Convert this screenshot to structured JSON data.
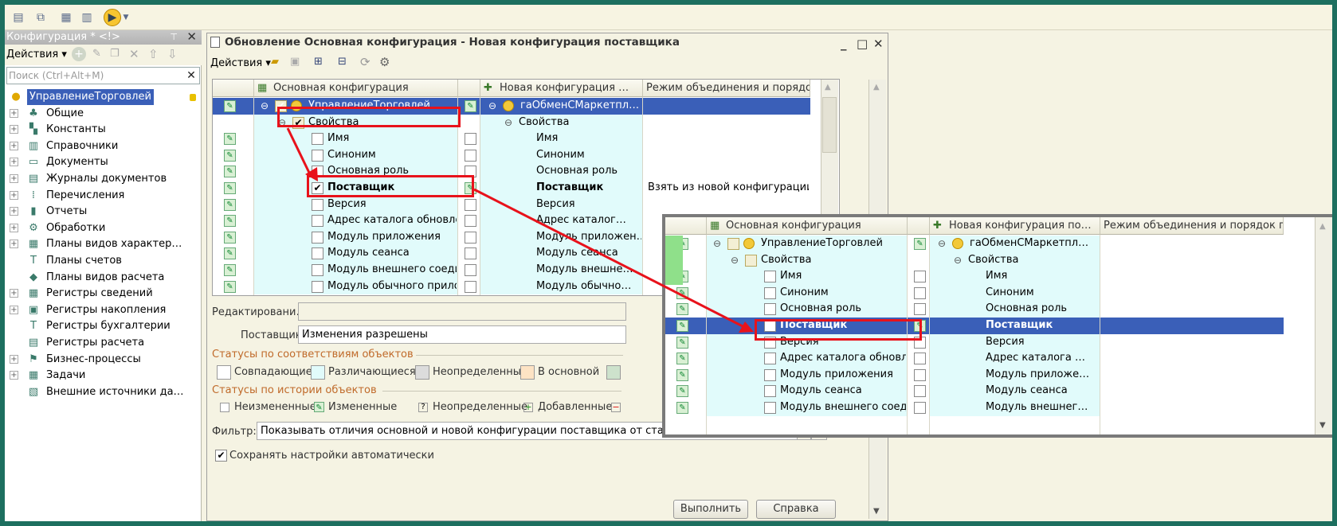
{
  "left_panel": {
    "title": "Конфигурация * <!>",
    "actions_label": "Действия",
    "search_placeholder": "Поиск (Ctrl+Alt+M)",
    "items": [
      {
        "label": "УправлениеТорговлей",
        "icon": "config-root-icon",
        "expand": false
      },
      {
        "label": "Общие",
        "icon": "common-icon",
        "expand": true
      },
      {
        "label": "Константы",
        "icon": "constants-icon",
        "expand": true
      },
      {
        "label": "Справочники",
        "icon": "catalogs-icon",
        "expand": true
      },
      {
        "label": "Документы",
        "icon": "documents-icon",
        "expand": true
      },
      {
        "label": "Журналы документов",
        "icon": "journals-icon",
        "expand": true
      },
      {
        "label": "Перечисления",
        "icon": "enums-icon",
        "expand": true
      },
      {
        "label": "Отчеты",
        "icon": "reports-icon",
        "expand": true
      },
      {
        "label": "Обработки",
        "icon": "processing-icon",
        "expand": true
      },
      {
        "label": "Планы видов характер…",
        "icon": "chart-types-icon",
        "expand": true
      },
      {
        "label": "Планы счетов",
        "icon": "chart-accounts-icon",
        "expand": false
      },
      {
        "label": "Планы видов расчета",
        "icon": "calc-types-icon",
        "expand": false
      },
      {
        "label": "Регистры сведений",
        "icon": "info-registers-icon",
        "expand": true
      },
      {
        "label": "Регистры накопления",
        "icon": "accum-registers-icon",
        "expand": true
      },
      {
        "label": "Регистры бухгалтерии",
        "icon": "account-registers-icon",
        "expand": false
      },
      {
        "label": "Регистры расчета",
        "icon": "calc-registers-icon",
        "expand": false
      },
      {
        "label": "Бизнес-процессы",
        "icon": "business-process-icon",
        "expand": true
      },
      {
        "label": "Задачи",
        "icon": "tasks-icon",
        "expand": true
      },
      {
        "label": "Внешние источники да…",
        "icon": "external-sources-icon",
        "expand": false
      }
    ]
  },
  "window": {
    "title": "Обновление Основная конфигурация - Новая конфигурация поставщика",
    "actions_label": "Действия",
    "columns": {
      "main": "Основная конфигурация",
      "new": "Новая конфигурация …",
      "mode": "Режим объединения и порядок …"
    },
    "rows": [
      {
        "main": "УправлениеТорговлей",
        "new": "гаОбменСМаркетпл…",
        "mode": "",
        "level": 0,
        "selected": true
      },
      {
        "main": "Свойства",
        "new": "Свойства",
        "mode": "",
        "level": 1
      },
      {
        "main": "Имя",
        "new": "Имя",
        "mode": "",
        "level": 2
      },
      {
        "main": "Синоним",
        "new": "Синоним",
        "mode": "",
        "level": 2
      },
      {
        "main": "Основная роль",
        "new": "Основная роль",
        "mode": "",
        "level": 2
      },
      {
        "main": "Поставщик",
        "new": "Поставщик",
        "mode": "Взять из новой конфигурации …",
        "level": 2,
        "bold": true,
        "checked": true
      },
      {
        "main": "Версия",
        "new": "Версия",
        "mode": "",
        "level": 2
      },
      {
        "main": "Адрес каталога обновле…",
        "new": "Адрес каталог…",
        "mode": "",
        "level": 2
      },
      {
        "main": "Модуль приложения",
        "new": "Модуль приложен…",
        "mode": "",
        "level": 2
      },
      {
        "main": "Модуль сеанса",
        "new": "Модуль сеанса",
        "mode": "",
        "level": 2
      },
      {
        "main": "Модуль внешнего соеди…",
        "new": "Модуль внешне…",
        "mode": "",
        "level": 2
      },
      {
        "main": "Модуль обычного прило…",
        "new": "Модуль обычно…",
        "mode": "",
        "level": 2
      }
    ],
    "edit_label": "Редактировани…",
    "supplier_label": "Поставщик:",
    "supplier_value": "Изменения разрешены",
    "status_match_title": "Статусы по соответствиям объектов",
    "status_match": {
      "same": "Совпадающие",
      "diff": "Различающиеся",
      "undef": "Неопределенные",
      "in_main": "В основной"
    },
    "status_hist_title": "Статусы по истории объектов",
    "status_hist": {
      "unchanged": "Неизмененные",
      "changed": "Измененные",
      "undef": "Неопределенные",
      "added": "Добавленные"
    },
    "filter_label": "Фильтр:",
    "filter_value": "Показывать отличия основной и новой конфигурации поставщика от старой конфигурации поставщика",
    "autosave_label": "Сохранять настройки автоматически",
    "run_button": "Выполнить",
    "help_button": "Справка"
  },
  "zoom": {
    "columns": {
      "main": "Основная конфигурация",
      "new": "Новая конфигурация по…",
      "mode": "Режим объединения и порядок п…"
    },
    "rows": [
      {
        "main": "УправлениеТорговлей",
        "new": "гаОбменСМаркетпл…",
        "level": 0
      },
      {
        "main": "Свойства",
        "new": "Свойства",
        "level": 1
      },
      {
        "main": "Имя",
        "new": "Имя",
        "level": 2
      },
      {
        "main": "Синоним",
        "new": "Синоним",
        "level": 2
      },
      {
        "main": "Основная роль",
        "new": "Основная роль",
        "level": 2
      },
      {
        "main": "Поставщик",
        "new": "Поставщик",
        "level": 2,
        "bold": true,
        "selected": true
      },
      {
        "main": "Версия",
        "new": "Версия",
        "level": 2
      },
      {
        "main": "Адрес каталога обновле…",
        "new": "Адрес каталога …",
        "level": 2
      },
      {
        "main": "Модуль приложения",
        "new": "Модуль приложе…",
        "level": 2
      },
      {
        "main": "Модуль сеанса",
        "new": "Модуль сеанса",
        "level": 2
      },
      {
        "main": "Модуль внешнего соеди…",
        "new": "Модуль внешнег…",
        "level": 2
      }
    ]
  },
  "colors": {
    "accent": "#3a5fb8",
    "highlight": "#e8121b",
    "diff_bg": "#e1fbfb",
    "changed_icon": "#d9f0d4"
  }
}
